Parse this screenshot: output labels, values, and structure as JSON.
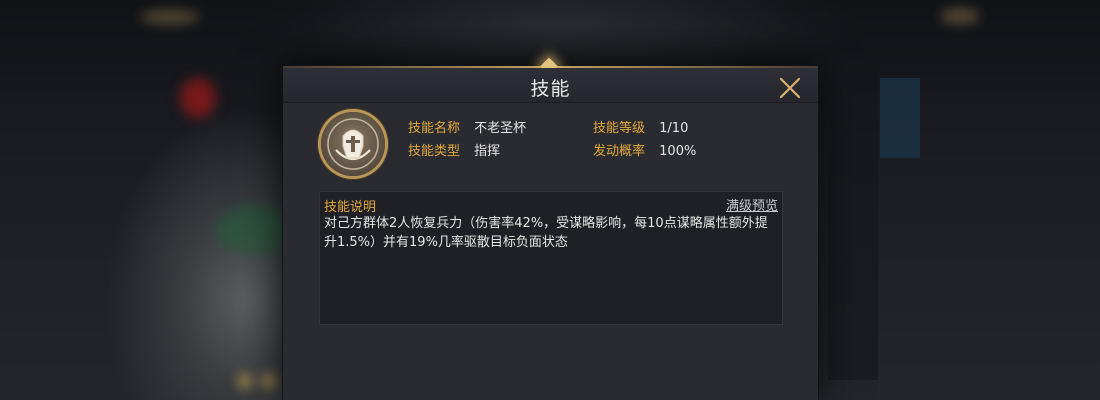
{
  "dialog": {
    "title": "技能",
    "close_icon": "close-icon"
  },
  "skill": {
    "icon": "helmet-emblem-icon",
    "name_label": "技能名称",
    "name_value": "不老圣杯",
    "level_label": "技能等级",
    "level_value": "1/10",
    "type_label": "技能类型",
    "type_value": "指挥",
    "chance_label": "发动概率",
    "chance_value": "100%"
  },
  "description": {
    "header": "技能说明",
    "preview_link": "满级预览",
    "text": "对己方群体2人恢复兵力（伤害率42%，受谋略影响，每10点谋略属性额外提升1.5%）并有19%几率驱散目标负面状态"
  },
  "colors": {
    "accent_gold": "#e3a93c",
    "panel_bg": "#2a2b31",
    "text": "#e6e6e6"
  }
}
